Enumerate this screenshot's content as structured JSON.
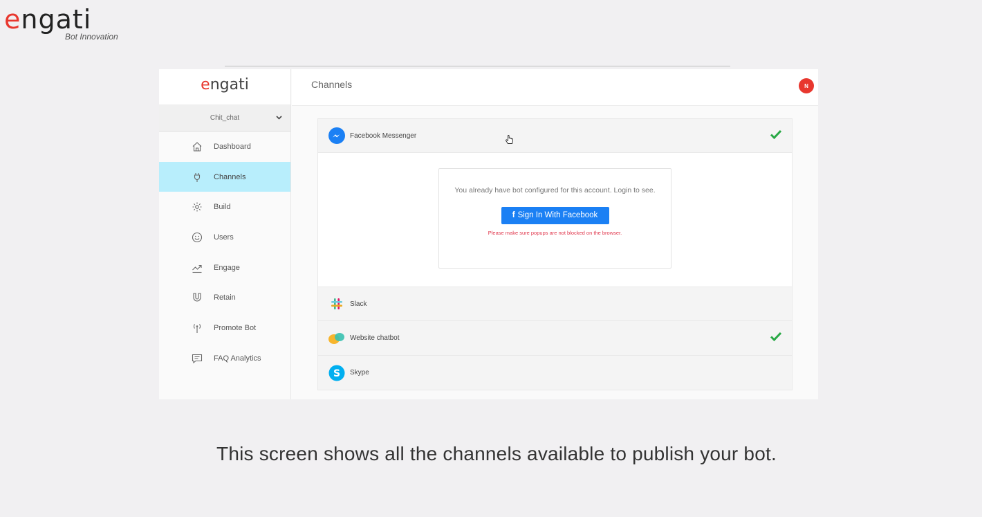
{
  "brand": {
    "wordmark_lead": "e",
    "wordmark_rest": "ngati",
    "tagline": "Bot Innovation"
  },
  "app": {
    "logo_lead": "e",
    "logo_rest": "ngati",
    "bot_selector": "Chit_chat",
    "page_title": "Channels",
    "avatar_initial": "N",
    "nav": [
      {
        "label": "Dashboard",
        "icon": "home-icon"
      },
      {
        "label": "Channels",
        "icon": "plug-icon"
      },
      {
        "label": "Build",
        "icon": "gear-icon"
      },
      {
        "label": "Users",
        "icon": "smiley-icon"
      },
      {
        "label": "Engage",
        "icon": "trend-icon"
      },
      {
        "label": "Retain",
        "icon": "magnet-icon"
      },
      {
        "label": "Promote Bot",
        "icon": "antenna-icon"
      },
      {
        "label": "FAQ Analytics",
        "icon": "chat-icon"
      }
    ],
    "active_nav": "Channels",
    "channels": [
      {
        "name": "Facebook Messenger",
        "icon": "messenger-icon",
        "configured": true
      },
      {
        "name": "Slack",
        "icon": "slack-icon",
        "configured": false
      },
      {
        "name": "Website chatbot",
        "icon": "chatbot-icon",
        "configured": true
      },
      {
        "name": "Skype",
        "icon": "skype-icon",
        "configured": false
      }
    ],
    "facebook_panel": {
      "message": "You already have bot configured for this account. Login to see.",
      "button_icon": "f",
      "button_label": "Sign In With Facebook",
      "warning": "Please make sure popups are not blocked on the browser."
    },
    "colors": {
      "accent_red": "#e8372e",
      "active_nav": "#b8eefc",
      "facebook_blue": "#1b80f4",
      "check_green": "#27a844"
    }
  },
  "caption": "This screen shows all the channels available to publish your bot."
}
